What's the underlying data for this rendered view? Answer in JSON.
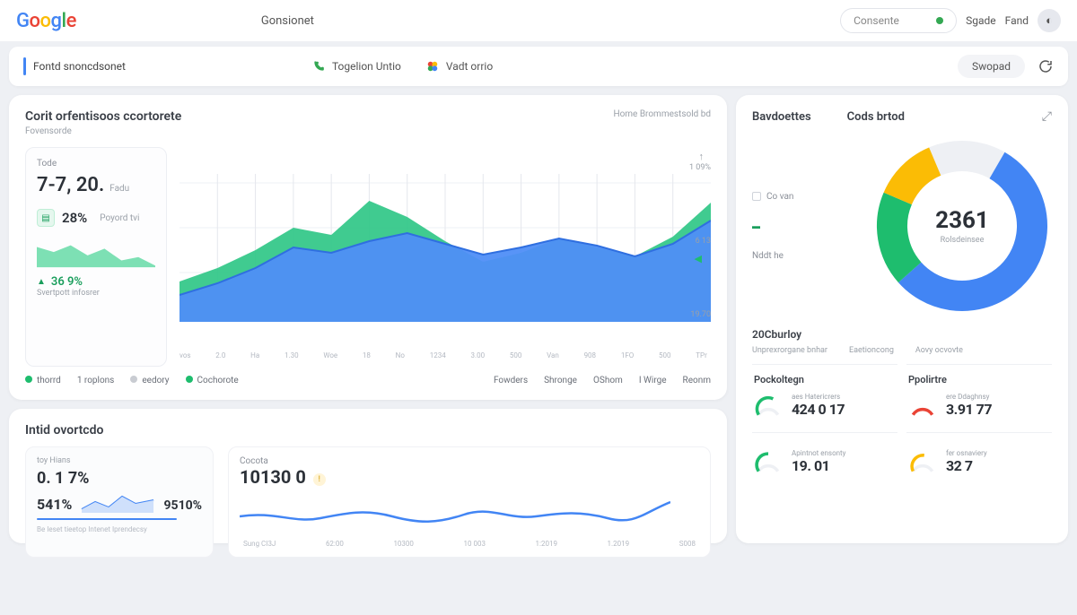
{
  "topbar": {
    "logo_letters": [
      "G",
      "o",
      "o",
      "g",
      "l",
      "e"
    ],
    "center_label": "Gonsionet",
    "search_placeholder": "Consente",
    "link1": "Sgade",
    "link2": "Fand",
    "avatar_glyph": "◐"
  },
  "subbar": {
    "left_label": "Fontd snoncdsonet",
    "item1": "Togelion Untio",
    "item2": "Vadt orrio",
    "button": "Swopad"
  },
  "main": {
    "title": "Corit orfentisoos ccortorete",
    "subtitle": "Fovensorde",
    "headline_right": "Home Brommestsold bd",
    "stat": {
      "label": "Tode",
      "big": "7-7, 20.",
      "big_suffix": "Fadu",
      "pct": "28%",
      "pct_suffix": "Poyord tvi",
      "delta": "36 9%",
      "delta_sub": "Svertpott infosrer"
    },
    "y_labels": [
      "1 09%",
      "6 13",
      "19.70"
    ],
    "x_ticks": [
      "vos",
      "2.0",
      "Ha",
      "1.30",
      "Woe",
      "18",
      "No",
      "1234",
      "3.00",
      "500",
      "Van",
      "908",
      "1FO",
      "500",
      "TPr"
    ],
    "legend": {
      "l1": "thorrd",
      "l2": "1 roplons",
      "l3": "eedory",
      "l4": "Cochorote",
      "r1": "Fowders",
      "r2": "Shronge",
      "r3": "OShom",
      "r4": "I Wirge",
      "r5": "Reonm"
    }
  },
  "right": {
    "tab1": "Bavdoettes",
    "tab2": "Cods brtod",
    "leg1": "Co van",
    "leg2": "Nddt he",
    "donut_value": "2361",
    "donut_sub": "Rolsdeinsee",
    "mid_label": "20Cburloy",
    "tabs": [
      "Unprexrorgane bnhar",
      "Eaetioncong",
      "Aovy ocvovte"
    ],
    "m1": {
      "title": "Pockoltegn",
      "tiny": "aes Hatericrers",
      "val": "424 0 17"
    },
    "m2": {
      "title": "Ppolirtre",
      "tiny": "ere Ddaghnsy",
      "val": "3.91 77"
    },
    "m3": {
      "title": "",
      "tiny": "Apintnot ensonty",
      "val": "19. 01"
    },
    "m4": {
      "title": "",
      "tiny": "fer osnaviery",
      "val": "32 7"
    }
  },
  "bottom": {
    "title": "Intid ovortcdo",
    "kpi": {
      "label": "toy Hians",
      "val": "0. 1 7%",
      "pct": "541%",
      "alt": "9510%",
      "foot": "Be Ieset tieetop Intenet Iprendecsy"
    },
    "line": {
      "title": "Cocota",
      "val": "10130 0",
      "xticks": [
        "Sung CI3J",
        "62:00",
        "10300",
        "10 003",
        "1:2019",
        "1.2019",
        "S008"
      ]
    }
  },
  "chart_data": [
    {
      "type": "area",
      "title": "Corit orfentisoos ccortorete",
      "x": [
        0,
        1,
        2,
        3,
        4,
        5,
        6,
        7,
        8,
        9,
        10,
        11,
        12,
        13,
        14
      ],
      "series": [
        {
          "name": "green",
          "color": "#1ebd6e",
          "values": [
            30,
            40,
            55,
            72,
            66,
            88,
            78,
            62,
            48,
            55,
            64,
            58,
            52,
            65,
            85
          ]
        },
        {
          "name": "blue",
          "color": "#4285F4",
          "values": [
            22,
            30,
            42,
            55,
            52,
            60,
            65,
            58,
            50,
            54,
            60,
            55,
            48,
            56,
            70
          ]
        }
      ],
      "ylim": [
        0,
        100
      ],
      "y_tick_labels": [
        "1 09%",
        "6 13",
        "19.70"
      ],
      "x_tick_labels": [
        "vos",
        "2.0",
        "Ha",
        "1.30",
        "Woe",
        "18",
        "No",
        "1234",
        "3.00",
        "500",
        "Van",
        "908",
        "1FO",
        "500",
        "TPr"
      ]
    },
    {
      "type": "pie",
      "title": "Bavdoettes",
      "center_value": 2361,
      "slices": [
        {
          "name": "blue",
          "color": "#4285F4",
          "value": 55
        },
        {
          "name": "green",
          "color": "#1ebd6e",
          "value": 18
        },
        {
          "name": "yellow",
          "color": "#FBBC05",
          "value": 12
        },
        {
          "name": "empty",
          "color": "#eef0f4",
          "value": 15
        }
      ]
    },
    {
      "type": "line",
      "title": "Cocota",
      "x": [
        0,
        1,
        2,
        3,
        4,
        5,
        6,
        7,
        8,
        9,
        10,
        11
      ],
      "values": [
        32,
        28,
        35,
        30,
        38,
        33,
        40,
        36,
        34,
        38,
        42,
        50
      ],
      "x_tick_labels": [
        "Sung CI3J",
        "62:00",
        "10300",
        "10 003",
        "1:2019",
        "1.2019",
        "S008"
      ]
    }
  ]
}
